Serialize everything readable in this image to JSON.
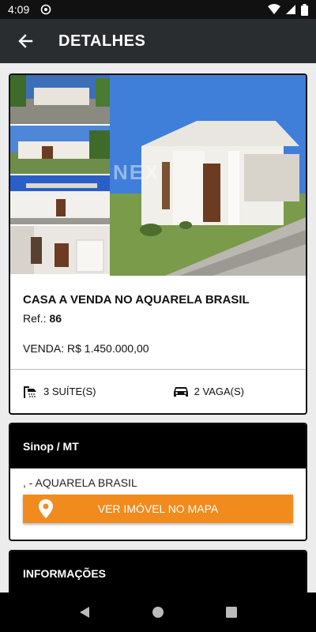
{
  "status_bar": {
    "time": "4:09"
  },
  "app_bar": {
    "title": "DETALHES"
  },
  "property": {
    "title": "CASA A VENDA NO AQUARELA BRASIL",
    "ref_label": "Ref.:",
    "ref_value": "86",
    "price": "VENDA: R$ 1.450.000,00",
    "watermark": "NEX",
    "features": {
      "suites": "3 SUÍTE(S)",
      "parking": "2 VAGA(S)"
    }
  },
  "location": {
    "city": "Sinop / MT",
    "address": ", - AQUARELA BRASIL",
    "map_button": "VER IMÓVEL NO MAPA"
  },
  "info_section": {
    "title": "INFORMAÇÕES"
  },
  "colors": {
    "accent": "#f28b1e",
    "app_bar": "#2a2d30"
  },
  "icons": [
    "back-arrow-icon",
    "shower-icon",
    "car-icon",
    "map-pin-icon",
    "nav-back-icon",
    "nav-home-icon",
    "nav-recents-icon"
  ]
}
